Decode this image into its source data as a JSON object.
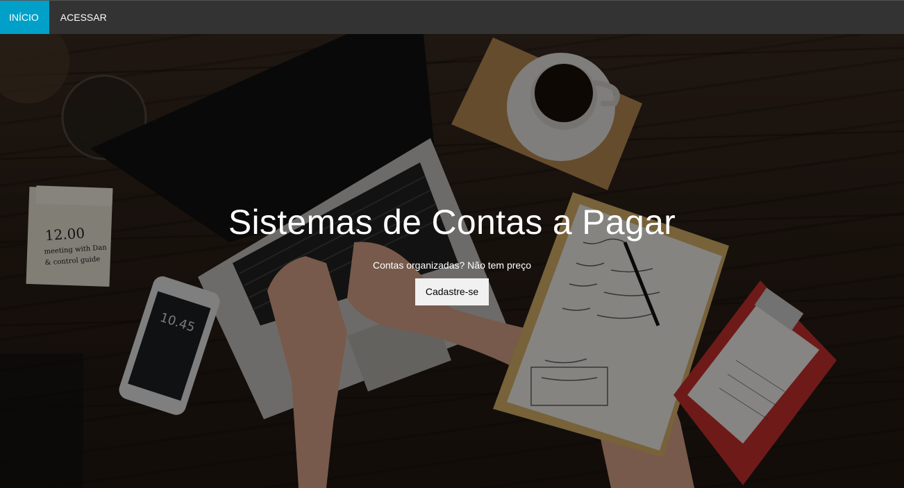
{
  "navbar": {
    "items": [
      {
        "label": "INÍCIO",
        "active": true
      },
      {
        "label": "ACESSAR",
        "active": false
      }
    ],
    "background": "#333333",
    "active_color": "#00a0c8"
  },
  "hero": {
    "title": "Sistemas de Contas a Pagar",
    "subtitle": "Contas organizadas? Não tem preço",
    "button_label": "Cadastre-se"
  },
  "background_image": {
    "notepad_text": [
      "12.00",
      "meeting with Dan",
      "& control guide"
    ],
    "phone_time": "10.45"
  }
}
